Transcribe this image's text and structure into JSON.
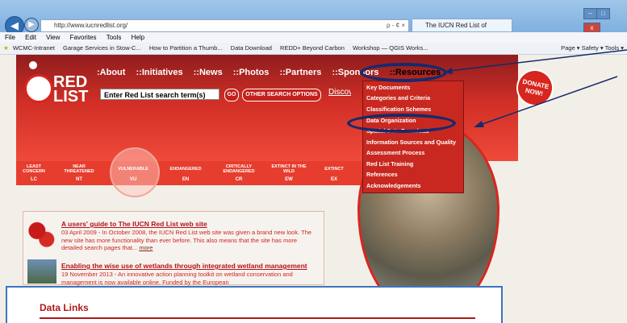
{
  "browser": {
    "address": "http://www.iucnredlist.org/",
    "address_tools": "ρ - ¢ ×",
    "tab_title": "The IUCN Red List of Threat...",
    "menu": [
      "File",
      "Edit",
      "View",
      "Favorites",
      "Tools",
      "Help"
    ],
    "favorites": [
      "WCMC-Intranet",
      "Garage Services in Stow-C...",
      "How to Partition a Thumb...",
      "Data Download",
      "REDD+ Beyond Carbon",
      "Workshop — QGIS Works..."
    ],
    "toolbar_right": "Page ▾  Safety ▾  Tools ▾",
    "window_buttons": [
      "–",
      "□",
      "x"
    ]
  },
  "site": {
    "logo_line1": "RED",
    "logo_line2": "LIST",
    "nav": [
      ":About",
      "::Initiatives",
      "::News",
      "::Photos",
      "::Partners",
      "::Sponsors",
      "::Resources"
    ],
    "search_placeholder": "Enter Red List search term(s)",
    "go_label": "GO",
    "options_label": "OTHER SEARCH OPTIONS",
    "discover_label": "Discover",
    "donate": "DONATE NOW!"
  },
  "categories": [
    {
      "name": "LEAST CONCERN",
      "code": "LC"
    },
    {
      "name": "NEAR THREATENED",
      "code": "NT"
    },
    {
      "name": "VULNERABLE",
      "code": "VU"
    },
    {
      "name": "ENDANGERED",
      "code": "EN"
    },
    {
      "name": "CRITICALLY ENDANGERED",
      "code": "CR"
    },
    {
      "name": "EXTINCT IN THE WILD",
      "code": "EW"
    },
    {
      "name": "EXTINCT",
      "code": "EX"
    }
  ],
  "resources_menu": [
    "Key Documents",
    "Categories and Criteria",
    "Classification Schemes",
    "Data Organization",
    "Spatial Data Download",
    "Information Sources and Quality",
    "Assessment Process",
    "Red List Training",
    "References",
    "Acknowledgements"
  ],
  "news": [
    {
      "title": "A users' guide to The IUCN Red List web site",
      "body": "03 April 2009 - In October 2008, the IUCN Red List web site was given a brand new look. The new site has more functionality than ever before. This also means that the site has more detailed search pages that...",
      "more": "more"
    },
    {
      "title": "Enabling the wise use of wetlands through integrated wetland management",
      "body": "19 November 2013 - An innovative action planning toolkit on wetland conservation and management is now available online. Funded by the European"
    }
  ],
  "overlay": {
    "title": "Data Links"
  },
  "colors": {
    "brand_red": "#d12f26",
    "annotation_blue": "#152a6e"
  }
}
